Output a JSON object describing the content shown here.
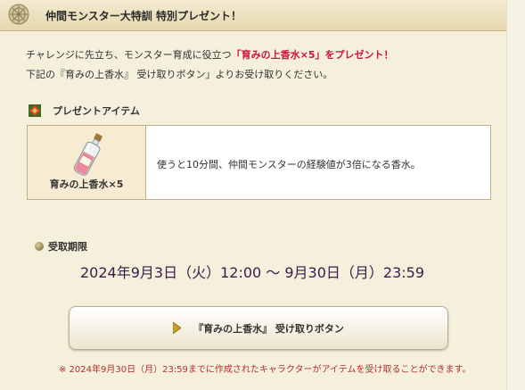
{
  "header": {
    "title": "仲間モンスター大特訓 特別プレゼント！",
    "icon": "compass-emblem-icon"
  },
  "intro": {
    "line1_prefix": "チャレンジに先立ち、モンスター育成に役立つ",
    "line1_highlight": "「育みの上香水×5」をプレゼント！",
    "line2": "下記の『育みの上香水』 受け取りボタン」よりお受け取りください。"
  },
  "present_section": {
    "heading": "プレゼントアイテム",
    "item": {
      "name": "育みの上香水×5",
      "description": "使うと10分間、仲間モンスターの経験値が3倍になる香水。",
      "icon": "perfume-bottle-icon"
    }
  },
  "period_section": {
    "heading": "受取期限",
    "text": "2024年9月3日（火）12:00 〜 9月30日（月）23:59"
  },
  "claim_button": {
    "label": "『育みの上香水』 受け取りボタン"
  },
  "note": "※ 2024年9月30日（月）23:59までに作成されたキャラクターがアイテムを受け取ることができます。",
  "colors": {
    "highlight": "#d01040",
    "period_text": "#3b1a4a",
    "background": "#f4f0dc"
  }
}
